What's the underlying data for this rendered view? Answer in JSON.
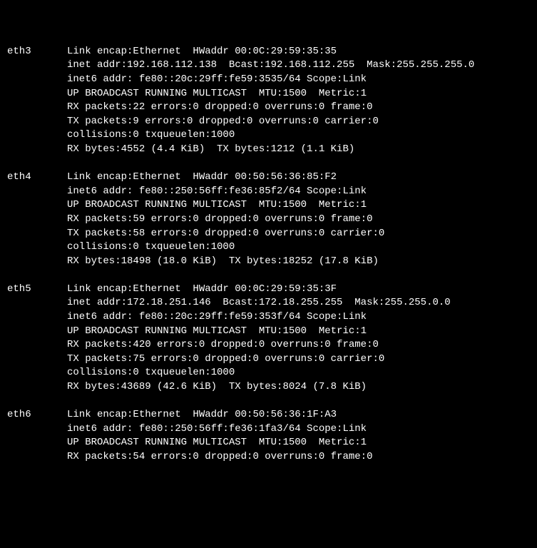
{
  "interfaces": [
    {
      "name": "eth3",
      "lines": [
        "Link encap:Ethernet  HWaddr 00:0C:29:59:35:35",
        "inet addr:192.168.112.138  Bcast:192.168.112.255  Mask:255.255.255.0",
        "inet6 addr: fe80::20c:29ff:fe59:3535/64 Scope:Link",
        "UP BROADCAST RUNNING MULTICAST  MTU:1500  Metric:1",
        "RX packets:22 errors:0 dropped:0 overruns:0 frame:0",
        "TX packets:9 errors:0 dropped:0 overruns:0 carrier:0",
        "collisions:0 txqueuelen:1000",
        "RX bytes:4552 (4.4 KiB)  TX bytes:1212 (1.1 KiB)"
      ]
    },
    {
      "name": "eth4",
      "lines": [
        "Link encap:Ethernet  HWaddr 00:50:56:36:85:F2",
        "inet6 addr: fe80::250:56ff:fe36:85f2/64 Scope:Link",
        "UP BROADCAST RUNNING MULTICAST  MTU:1500  Metric:1",
        "RX packets:59 errors:0 dropped:0 overruns:0 frame:0",
        "TX packets:58 errors:0 dropped:0 overruns:0 carrier:0",
        "collisions:0 txqueuelen:1000",
        "RX bytes:18498 (18.0 KiB)  TX bytes:18252 (17.8 KiB)"
      ]
    },
    {
      "name": "eth5",
      "lines": [
        "Link encap:Ethernet  HWaddr 00:0C:29:59:35:3F",
        "inet addr:172.18.251.146  Bcast:172.18.255.255  Mask:255.255.0.0",
        "inet6 addr: fe80::20c:29ff:fe59:353f/64 Scope:Link",
        "UP BROADCAST RUNNING MULTICAST  MTU:1500  Metric:1",
        "RX packets:420 errors:0 dropped:0 overruns:0 frame:0",
        "TX packets:75 errors:0 dropped:0 overruns:0 carrier:0",
        "collisions:0 txqueuelen:1000",
        "RX bytes:43689 (42.6 KiB)  TX bytes:8024 (7.8 KiB)"
      ]
    },
    {
      "name": "eth6",
      "lines": [
        "Link encap:Ethernet  HWaddr 00:50:56:36:1F:A3",
        "inet6 addr: fe80::250:56ff:fe36:1fa3/64 Scope:Link",
        "UP BROADCAST RUNNING MULTICAST  MTU:1500  Metric:1",
        "RX packets:54 errors:0 dropped:0 overruns:0 frame:0"
      ]
    }
  ]
}
